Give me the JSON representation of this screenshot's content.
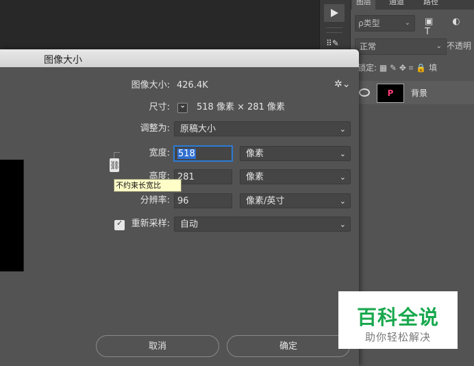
{
  "panel": {
    "tabs": [
      "图层",
      "通道",
      "路径"
    ],
    "filter_kind": "ρ类型",
    "filter_icons": [
      "image-filter-icon",
      "adjustment-filter-icon",
      "type-filter-icon"
    ],
    "filter_icon_glyphs": "▣ ◐ T",
    "blend_mode": "正常",
    "opacity_label": "不透明",
    "lock_label": "锁定:",
    "lock_icons_text": "▦ ✎ ✥ ⌗ 🔒 填",
    "layer": {
      "name": "背景",
      "thumb_text": "P"
    }
  },
  "dialog": {
    "title": "图像大小",
    "image_size_label": "图像大小:",
    "image_size_value": "426.4K",
    "dimensions_label": "尺寸:",
    "dimensions_value": "518 像素 × 281 像素",
    "fit_to_label": "调整为:",
    "fit_to_value": "原稿大小",
    "width_label": "宽度:",
    "width_value": "518",
    "width_unit": "像素",
    "height_label": "高度:",
    "height_value": "281",
    "height_unit": "像素",
    "resolution_label": "分辨率:",
    "resolution_value": "96",
    "resolution_unit": "像素/英寸",
    "resample_label": "重新采样:",
    "resample_value": "自动",
    "resample_checked": true,
    "tooltip": "不约束长宽比",
    "cancel_label": "取消",
    "ok_label": "确定"
  },
  "watermark": {
    "title": "百科全说",
    "subtitle": "助你轻松解决"
  },
  "colors": {
    "accent": "#2a7bd6",
    "watermark_green": "#19a84e",
    "dialog_bg": "#535353"
  }
}
